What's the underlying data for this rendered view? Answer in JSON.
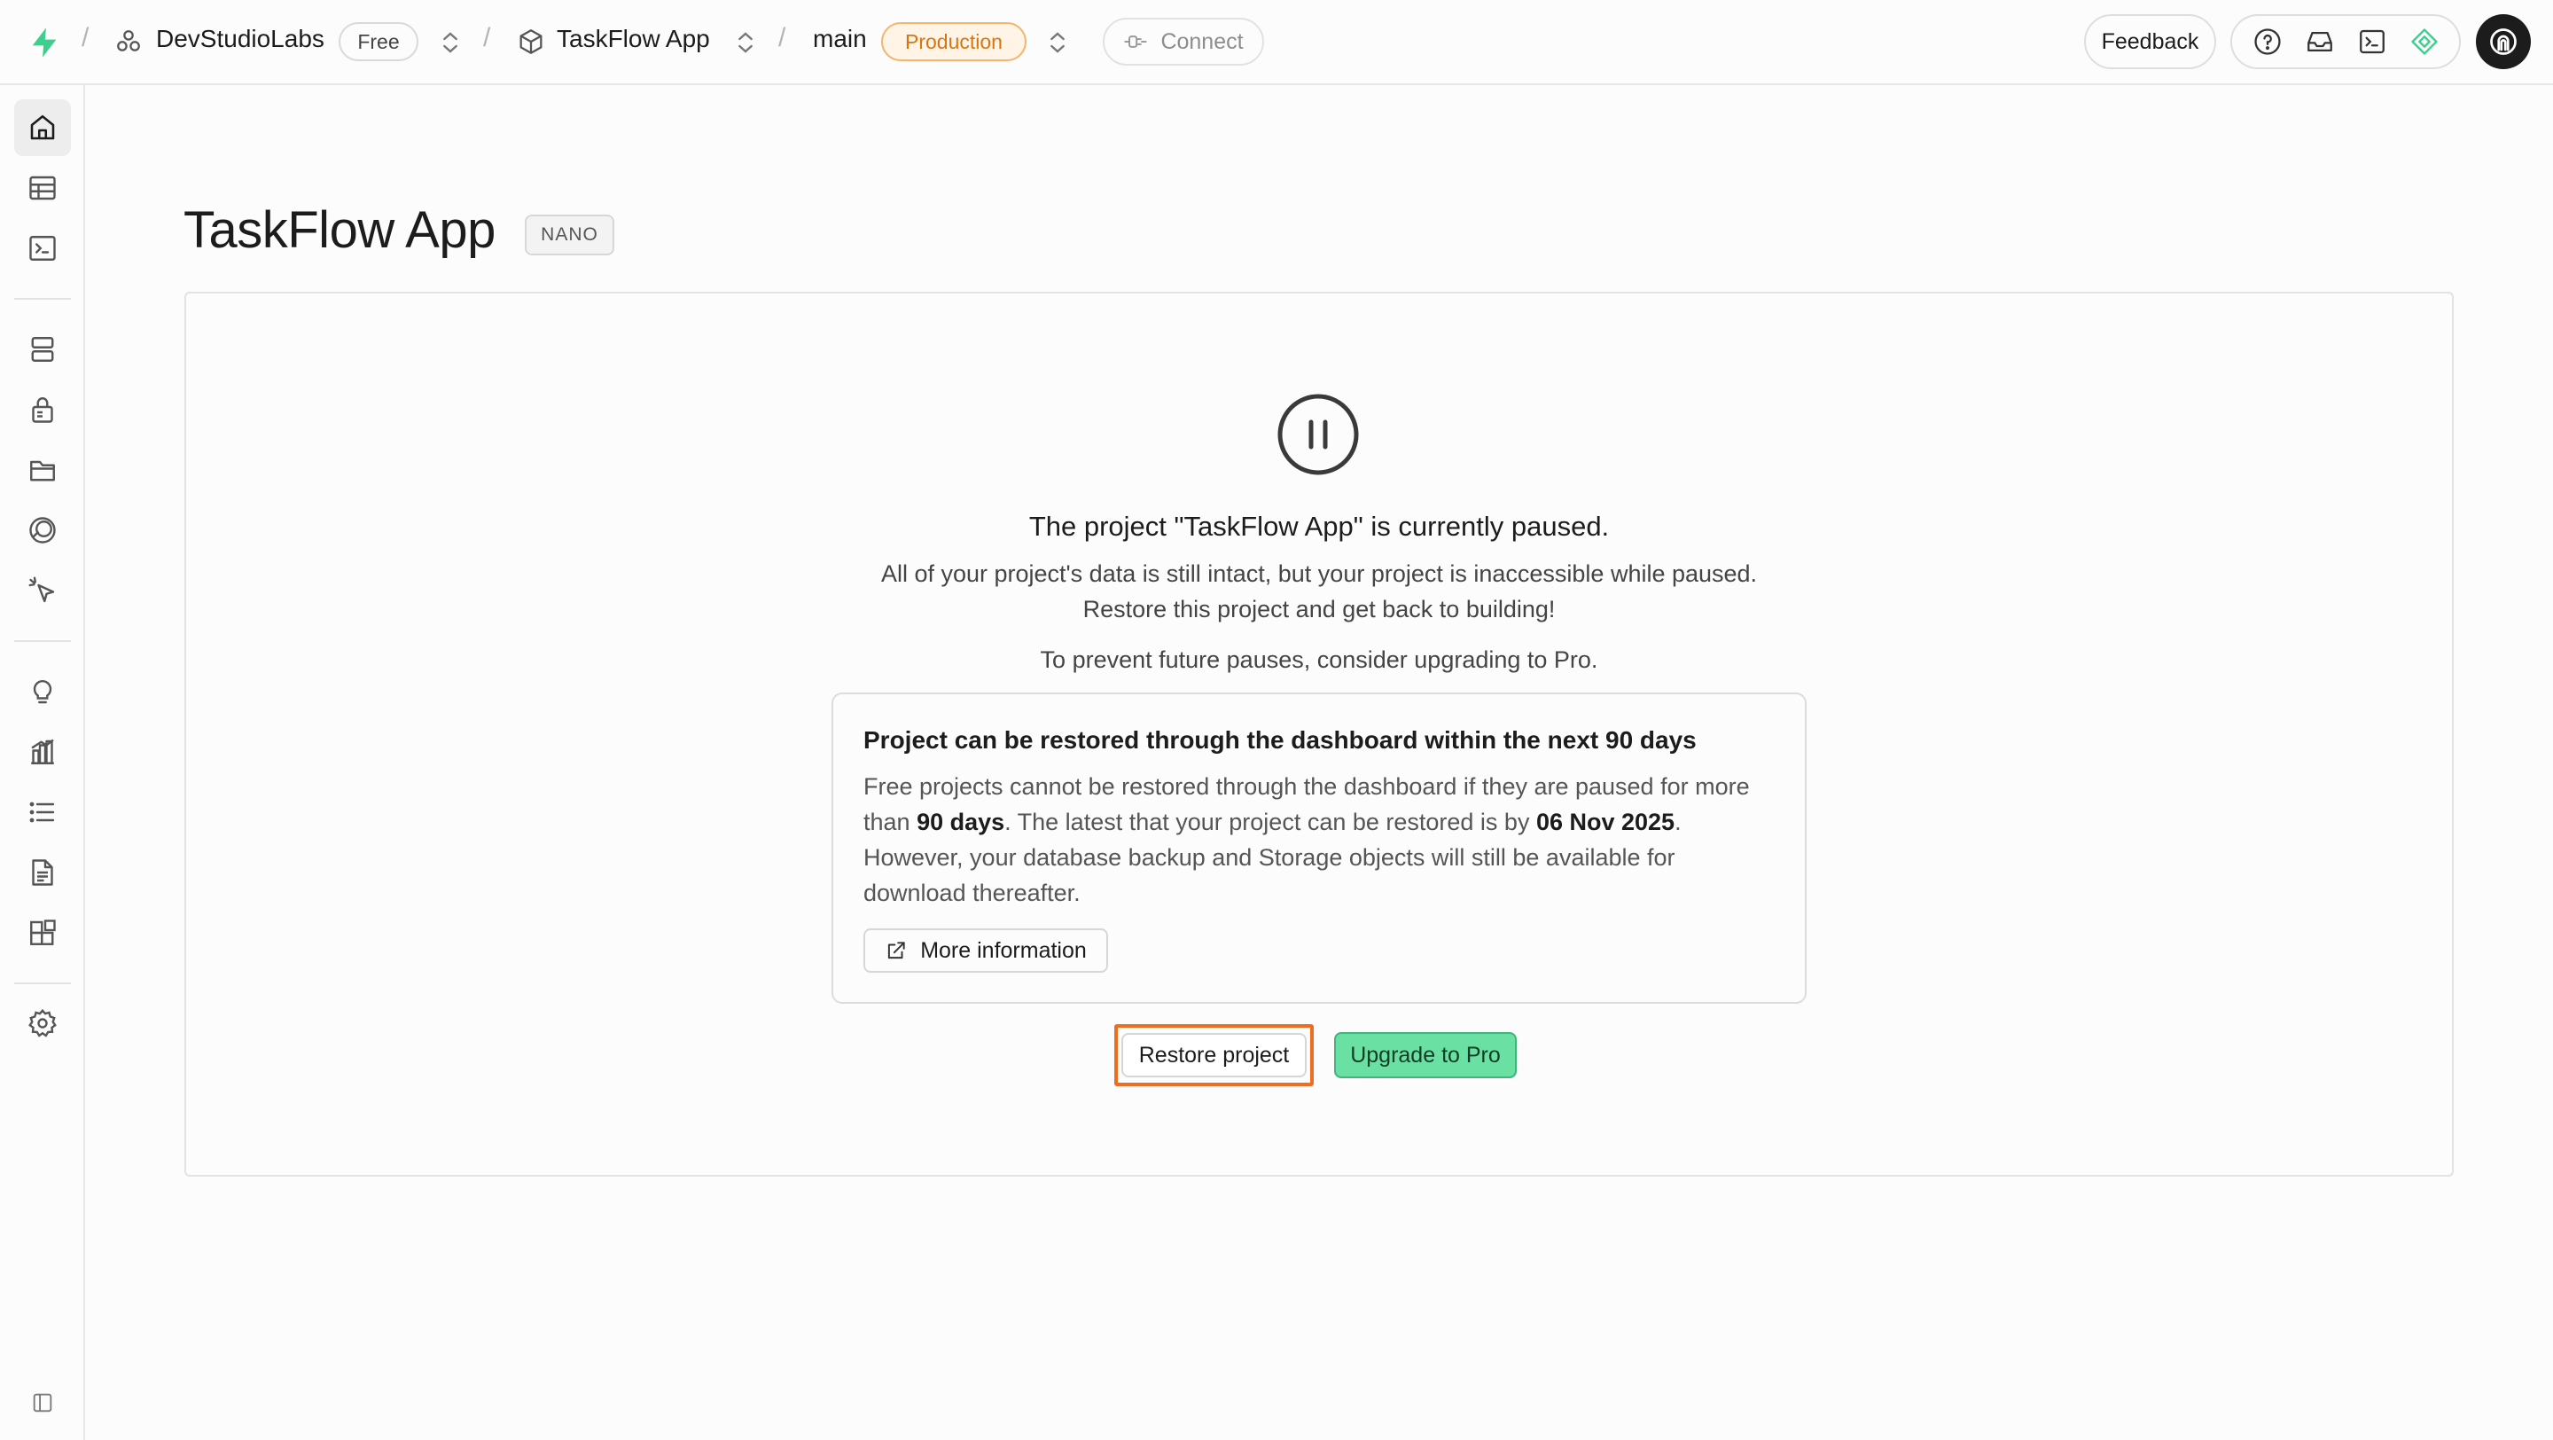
{
  "topbar": {
    "org_name": "DevStudioLabs",
    "plan_badge": "Free",
    "project_name": "TaskFlow App",
    "branch_name": "main",
    "env_badge": "Production",
    "connect_label": "Connect",
    "feedback_label": "Feedback",
    "icons": [
      "help-icon",
      "inbox-icon",
      "terminal-icon",
      "advisor-icon",
      "user-avatar-icon"
    ]
  },
  "sidebar": {
    "items": [
      {
        "icon": "home-icon",
        "active": true
      },
      {
        "icon": "table-editor-icon"
      },
      {
        "icon": "sql-editor-icon"
      },
      {
        "icon": "database-icon"
      },
      {
        "icon": "authentication-icon"
      },
      {
        "icon": "storage-icon"
      },
      {
        "icon": "realtime-icon"
      },
      {
        "icon": "edge-functions-icon"
      },
      {
        "icon": "advisors-icon"
      },
      {
        "icon": "reports-icon"
      },
      {
        "icon": "logs-icon"
      },
      {
        "icon": "api-docs-icon"
      },
      {
        "icon": "integrations-icon"
      },
      {
        "icon": "settings-icon"
      },
      {
        "icon": "collapse-sidebar-icon"
      }
    ]
  },
  "main": {
    "title": "TaskFlow App",
    "compute_badge": "NANO",
    "paused": {
      "heading": "The project \"TaskFlow App\" is currently paused.",
      "line1": "All of your project's data is still intact, but your project is inaccessible while paused.",
      "line2": "Restore this project and get back to building!",
      "line3": "To prevent future pauses, consider upgrading to Pro."
    },
    "info_box": {
      "title": "Project can be restored through the dashboard within the next 90 days",
      "body_part1": "Free projects cannot be restored through the dashboard if they are paused for more than ",
      "body_bold1": "90 days",
      "body_part2": ". The latest that your project can be restored is by ",
      "body_bold2": "06 Nov 2025",
      "body_part3": ". However, your database backup and Storage objects will still be available for download thereafter.",
      "more_info_label": "More information"
    },
    "restore_label": "Restore project",
    "upgrade_label": "Upgrade to Pro"
  },
  "colors": {
    "accent_green": "#3ecf8e",
    "upgrade_green": "#6be0a3",
    "production_orange": "#d9750f",
    "highlight_orange": "#ef6d1e"
  }
}
